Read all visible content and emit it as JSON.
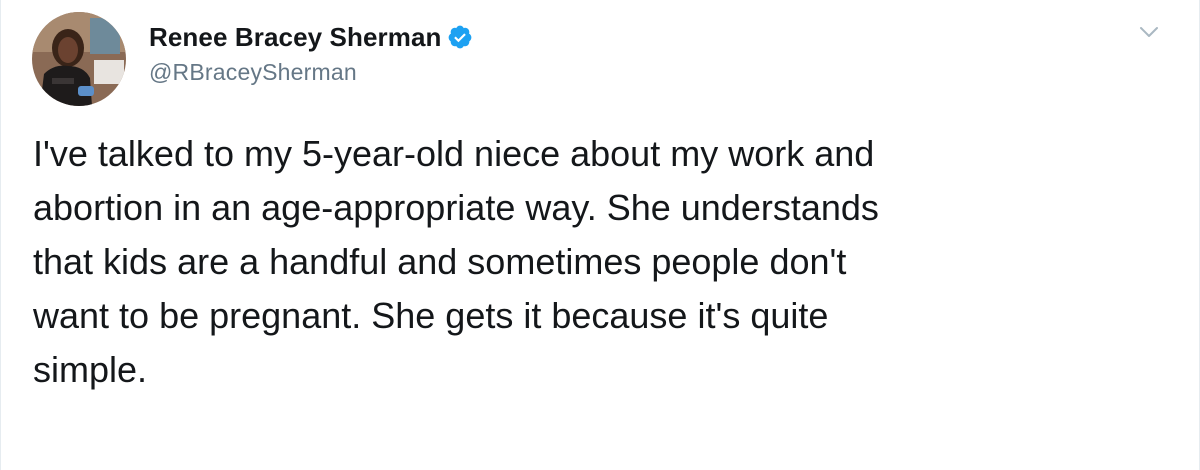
{
  "author": {
    "display_name": "Renee Bracey Sherman",
    "handle": "@RBraceySherman",
    "verified": true
  },
  "tweet": {
    "text": "I've talked to my 5-year-old niece about my work and\nabortion in an age-appropriate way. She understands\nthat kids are a handful and sometimes people don't\nwant to be pregnant. She gets it because it's quite\nsimple."
  },
  "icons": {
    "verified": "verified-badge-icon",
    "menu": "chevron-down-icon"
  },
  "colors": {
    "name_text": "#14171a",
    "handle_text": "#657786",
    "verified_badge": "#1da1f2",
    "caret": "#aab8c2"
  }
}
